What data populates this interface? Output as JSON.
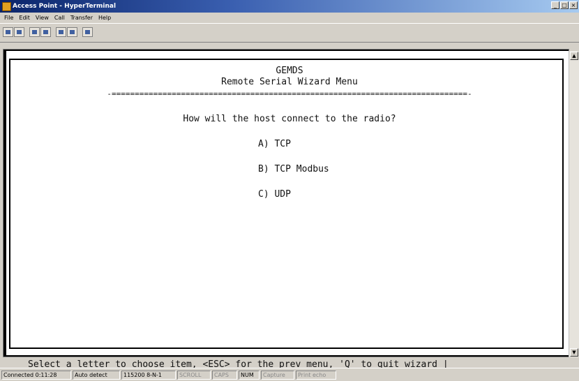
{
  "window": {
    "title": "Access Point - HyperTerminal",
    "controls": [
      "_",
      "□",
      "×"
    ]
  },
  "menu": [
    "File",
    "Edit",
    "View",
    "Call",
    "Transfer",
    "Help"
  ],
  "toolbar_icons": [
    "new-icon",
    "open-icon",
    "phone-icon",
    "disconnect-icon",
    "send-icon",
    "receive-icon",
    "properties-icon"
  ],
  "terminal": {
    "header": "GEMDS",
    "menu_title": "Remote Serial Wizard Menu",
    "separator": "-=============================================================================-",
    "question": "How will the host connect to the radio?",
    "options": [
      "A) TCP",
      "B) TCP Modbus",
      "C) UDP"
    ],
    "prompt": "Select a letter to choose item, <ESC> for the prev menu, 'Q' to quit wizard |"
  },
  "status": {
    "connected": "Connected 0:11:28",
    "detect": "Auto detect",
    "baud": "115200 8-N-1",
    "scroll": "SCROLL",
    "caps": "CAPS",
    "num": "NUM",
    "capture": "Capture",
    "print": "Print echo"
  }
}
